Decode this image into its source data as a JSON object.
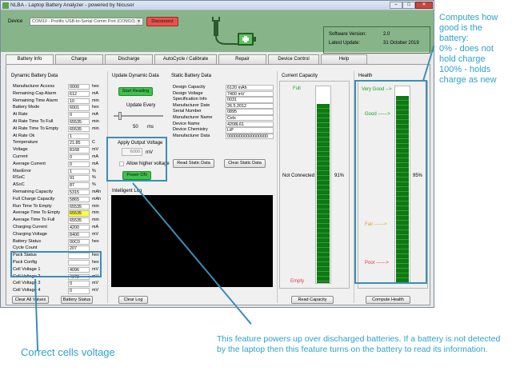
{
  "window": {
    "title": "NLBA - Laptop Battery Analyzer - powered by Nicusor",
    "min": "–",
    "max": "□",
    "close": "✕"
  },
  "header": {
    "device_label": "Device",
    "device_value": "COM10 - Prolific USB-to-Serial Comm Port (COM10)",
    "disconnect": "Disconnect",
    "sw_version_label": "Software Version:",
    "sw_version": "2.0",
    "latest_update_label": "Latest Update:",
    "latest_update": "31 October 2019"
  },
  "tabs": [
    "Battery Info",
    "Charge",
    "Discharge",
    "AutoCycle / Calibrate",
    "Repair",
    "Device Control",
    "Help"
  ],
  "dynamic": {
    "title": "Dynamic Battery Data",
    "rows": [
      {
        "k": "Manufacturer Access",
        "v": "0000",
        "u": "hex"
      },
      {
        "k": "Remaining Cap Alarm",
        "v": "612",
        "u": "mA"
      },
      {
        "k": "Remaining Time Alarm",
        "v": "10",
        "u": "min"
      },
      {
        "k": "Battery Mode",
        "v": "6001",
        "u": "hex"
      },
      {
        "k": "At Rate",
        "v": "0",
        "u": "mA"
      },
      {
        "k": "At Rate Time To Full",
        "v": "65535",
        "u": "min"
      },
      {
        "k": "At Rate Time To Empty",
        "v": "65535",
        "u": "min"
      },
      {
        "k": "At Rate Ok",
        "v": "1",
        "u": ""
      },
      {
        "k": "Temperature",
        "v": "21.85",
        "u": "C"
      },
      {
        "k": "Voltage",
        "v": "8168",
        "u": "mV"
      },
      {
        "k": "Current",
        "v": "0",
        "u": "mA"
      },
      {
        "k": "Average Current",
        "v": "0",
        "u": "mA"
      },
      {
        "k": "MaxError",
        "v": "1",
        "u": "%"
      },
      {
        "k": "RSoC",
        "v": "91",
        "u": "%"
      },
      {
        "k": "ASoC",
        "v": "87",
        "u": "%"
      },
      {
        "k": "Remaining Capacity",
        "v": "5315",
        "u": "mAh"
      },
      {
        "k": "Full Charge Capacity",
        "v": "5865",
        "u": "mAh"
      },
      {
        "k": "Run Time To Empty",
        "v": "65535",
        "u": "min"
      },
      {
        "k": "Average Time To Empty",
        "v": "65535",
        "u": "min",
        "hl": true
      },
      {
        "k": "Average Time To Full",
        "v": "65535",
        "u": "min"
      },
      {
        "k": "Charging Current",
        "v": "4200",
        "u": "mA"
      },
      {
        "k": "Charging Voltage",
        "v": "8400",
        "u": "mV"
      },
      {
        "k": "Battery Status",
        "v": "00C0",
        "u": "hex"
      },
      {
        "k": "Cycle Count",
        "v": "207",
        "u": ""
      },
      {
        "k": "Pack Status",
        "v": "",
        "u": "hex"
      },
      {
        "k": "Pack Config",
        "v": "",
        "u": "hex"
      },
      {
        "k": "Cell Voltage 1",
        "v": "4096",
        "u": "mV"
      },
      {
        "k": "Cell Voltage 2",
        "v": "4072",
        "u": "mV"
      },
      {
        "k": "Cell Voltage 3",
        "v": "0",
        "u": "mV"
      },
      {
        "k": "Cell Voltage 4",
        "v": "0",
        "u": "mV"
      }
    ],
    "clear_all": "Clear All Values",
    "battery_status": "Battery Status"
  },
  "update": {
    "title": "Update Dynamic Data",
    "start": "Start Reading",
    "every_label": "Update Every",
    "every_value": "50",
    "every_unit": "ms",
    "slider_level": 0.1
  },
  "output": {
    "title": "Apply Output Voltage",
    "value": "6000",
    "unit": "mV",
    "allow_higher": "Allow higher voltage",
    "power_on": "Power ON"
  },
  "log": {
    "title": "Intelligent Log",
    "clear": "Clear Log"
  },
  "static": {
    "title": "Static Battery Data",
    "rows": [
      {
        "k": "Design Capacity",
        "v": "6120 mAh"
      },
      {
        "k": "Design Voltage",
        "v": "7400 mV"
      },
      {
        "k": "Specification Info",
        "v": "0031"
      },
      {
        "k": "Manufacturer Date",
        "v": "26.5.2012"
      },
      {
        "k": "Serial Number",
        "v": "0895"
      },
      {
        "k": "Manufacturer Name",
        "v": "Celx"
      },
      {
        "k": "Device Name",
        "v": "4208L61"
      },
      {
        "k": "Device Chemistry",
        "v": "LiP"
      },
      {
        "k": "Manufacturer Data",
        "v": "00000000000000000"
      }
    ],
    "read": "Read Static Data",
    "clear": "Clear Static Data"
  },
  "capacity": {
    "title": "Current Capacity",
    "full": "Full",
    "empty": "Empty",
    "status": "Not Connected",
    "percent": "91%",
    "level": 0.91,
    "read": "Read Capacity"
  },
  "health": {
    "title": "Health",
    "very_good": "Very Good -->",
    "good": "Good ------>",
    "fair": "Fair ------>",
    "poor": "Poor ------>",
    "percent": "95%",
    "level": 0.95,
    "compute": "Compute Health"
  },
  "notes": {
    "health": "Computes how good is the battery:\n0% - does not hold charge\n100% - holds charge as new",
    "cells": "Correct cells voltage",
    "power": "This feature powers up over discharged batteries. If a battery is not detected by the laptop then this feature turns on the battery to read its information."
  },
  "colors": {
    "accent": "#2ea2c9",
    "header": "#87b589",
    "bar": "#0d7a12",
    "disconnect": "#e8514a",
    "button_green": "#3ec24b"
  }
}
